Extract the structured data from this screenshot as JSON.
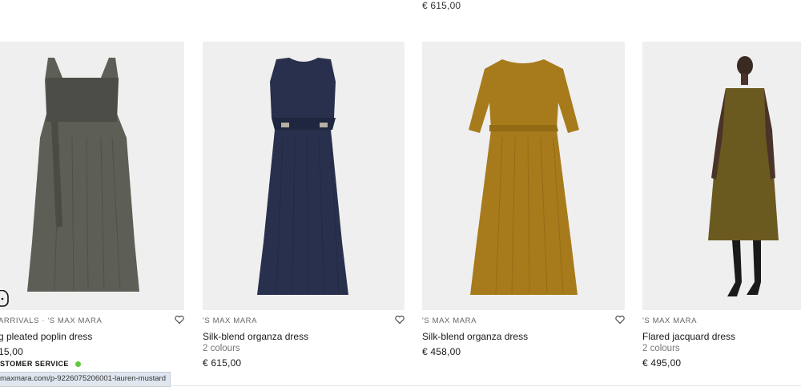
{
  "top_price": "€ 615,00",
  "colors": {
    "image_bg": "#efefef",
    "online_dot": "#5fc83c",
    "status_bg": "#dfe6ef"
  },
  "products": [
    {
      "brand": "ARRIVALS · 'S MAX MARA",
      "name": "g pleated poplin dress",
      "colours": "",
      "price": "15,00",
      "dress_color": "#5d5e56",
      "icon": "heart-icon"
    },
    {
      "brand": "'S MAX MARA",
      "name": "Silk-blend organza dress",
      "colours": "2 colours",
      "price": "€ 615,00",
      "dress_color": "#28304d",
      "icon": "heart-icon"
    },
    {
      "brand": "'S MAX MARA",
      "name": "Silk-blend organza dress",
      "colours": "",
      "price": "€ 458,00",
      "dress_color": "#a77b1b",
      "icon": "heart-icon"
    },
    {
      "brand": "'S MAX MARA",
      "name": "Flared jacquard dress",
      "colours": "2 colours",
      "price": "€ 495,00",
      "dress_color": "#6b5a1f",
      "icon": "heart-icon"
    }
  ],
  "customer_service": {
    "label": "STOMER SERVICE",
    "icon": "chat-bubble-icon",
    "status": "online"
  },
  "status_bar": {
    "url": "maxmara.com/p-9226075206001-lauren-mustard"
  }
}
